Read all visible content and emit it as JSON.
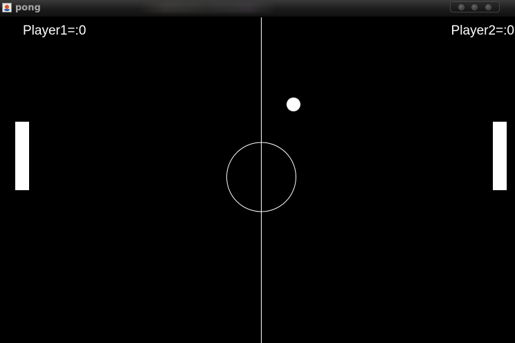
{
  "window": {
    "title": "pong",
    "icon": "java-cup-icon"
  },
  "scores": {
    "player1_label": "Player1=:0",
    "player2_label": "Player2=:0"
  },
  "colors": {
    "background": "#000000",
    "foreground": "#ffffff"
  }
}
